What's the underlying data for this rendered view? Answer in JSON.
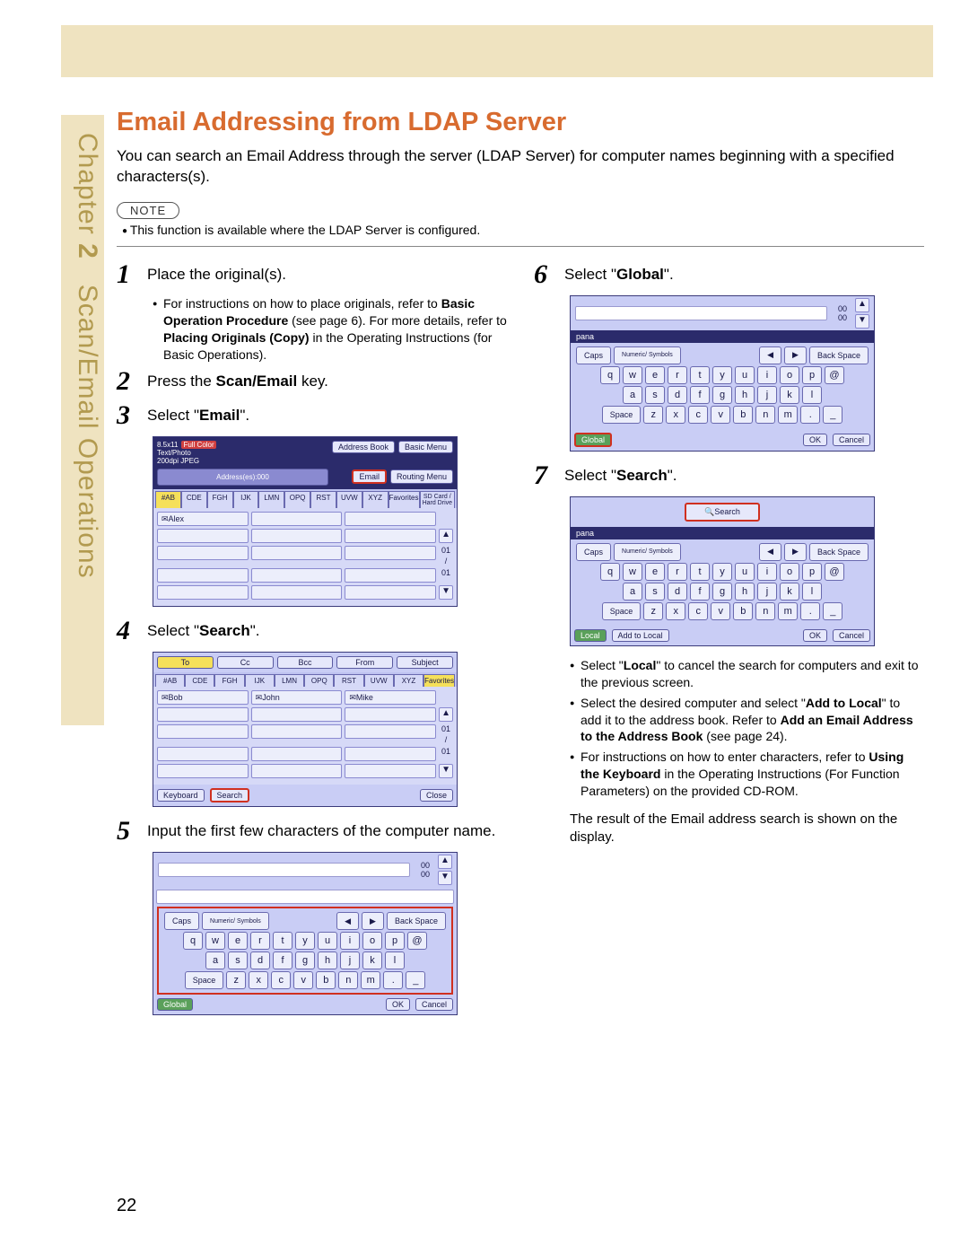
{
  "sidebar": {
    "chapter_label": "Chapter",
    "chapter_num": "2",
    "section": "Scan/Email Operations"
  },
  "title": "Email Addressing from LDAP Server",
  "intro": "You can search an Email Address through the server (LDAP Server) for computer names beginning with a specified characters(s).",
  "note_label": "NOTE",
  "note_text": "This function is available where the LDAP Server is configured.",
  "page_number": "22",
  "steps": {
    "s1": {
      "num": "1",
      "text_a": "Place the original(s).",
      "sub_a": "For instructions on how to place originals, refer to ",
      "sub_b": "Basic Operation Procedure",
      "sub_c": " (see page 6). For more details, refer to ",
      "sub_d": "Placing Originals (Copy)",
      "sub_e": " in the Operating Instructions (for Basic Operations)."
    },
    "s2": {
      "num": "2",
      "text_a": "Press the ",
      "text_b": "Scan/Email",
      "text_c": " key."
    },
    "s3": {
      "num": "3",
      "text_a": "Select \"",
      "text_b": "Email",
      "text_c": "\"."
    },
    "s4": {
      "num": "4",
      "text_a": "Select \"",
      "text_b": "Search",
      "text_c": "\"."
    },
    "s5": {
      "num": "5",
      "text_a": "Input the first few characters of the computer name."
    },
    "s6": {
      "num": "6",
      "text_a": "Select \"",
      "text_b": "Global",
      "text_c": "\"."
    },
    "s7": {
      "num": "7",
      "text_a": "Select \"",
      "text_b": "Search",
      "text_c": "\"."
    }
  },
  "step7_notes": {
    "a1": "Select \"",
    "a2": "Local",
    "a3": "\" to cancel the search for computers and exit to the previous screen.",
    "b1": "Select the desired computer and select \"",
    "b2": "Add to Local",
    "b3": "\" to add it to the address book. Refer to ",
    "b4": "Add an Email Address to the Address Book",
    "b5": " (see page 24).",
    "c1": "For instructions on how to enter characters, refer to ",
    "c2": "Using the Keyboard",
    "c3": " in the Operating Instructions (For Function Parameters) on the provided CD-ROM."
  },
  "result_text": "The result of the Email address search is shown on the display.",
  "shot3": {
    "info1": "8.5x11",
    "info2": "Full Color",
    "info3": "Text/Photo",
    "info4": "200dpi JPEG",
    "address_book": "Address Book",
    "basic_menu": "Basic Menu",
    "address_count": "Address(es):000",
    "email": "Email",
    "routing_menu": "Routing Menu",
    "tabs": [
      "#AB",
      "CDE",
      "FGH",
      "IJK",
      "LMN",
      "OPQ",
      "RST",
      "UVW",
      "XYZ",
      "Favorites"
    ],
    "sd": "SD Card / Hard Drive",
    "name1": "Alex",
    "count_top": "01",
    "count_bot": "01"
  },
  "shot4": {
    "top": [
      "To",
      "Cc",
      "Bcc",
      "From",
      "Subject"
    ],
    "tabs": [
      "#AB",
      "CDE",
      "FGH",
      "IJK",
      "LMN",
      "OPQ",
      "RST",
      "UVW",
      "XYZ",
      "Favorites"
    ],
    "names": [
      "Bob",
      "John",
      "Mike"
    ],
    "keyboard": "Keyboard",
    "search": "Search",
    "close": "Close",
    "count_top": "01",
    "count_bot": "01"
  },
  "kb": {
    "pana": "pana",
    "caps": "Caps",
    "numsym": "Numeric/\nSymbols",
    "backspace": "Back Space",
    "left": "◀",
    "right": "▶",
    "row1": [
      "q",
      "w",
      "e",
      "r",
      "t",
      "y",
      "u",
      "i",
      "o",
      "p",
      "@"
    ],
    "row2": [
      "a",
      "s",
      "d",
      "f",
      "g",
      "h",
      "j",
      "k",
      "l"
    ],
    "row3": [
      "z",
      "x",
      "c",
      "v",
      "b",
      "n",
      "m",
      ".",
      "_"
    ],
    "space": "Space",
    "global": "Global",
    "local": "Local",
    "add_local": "Add to Local",
    "ok": "OK",
    "cancel": "Cancel",
    "count": "00",
    "search": "Search"
  }
}
